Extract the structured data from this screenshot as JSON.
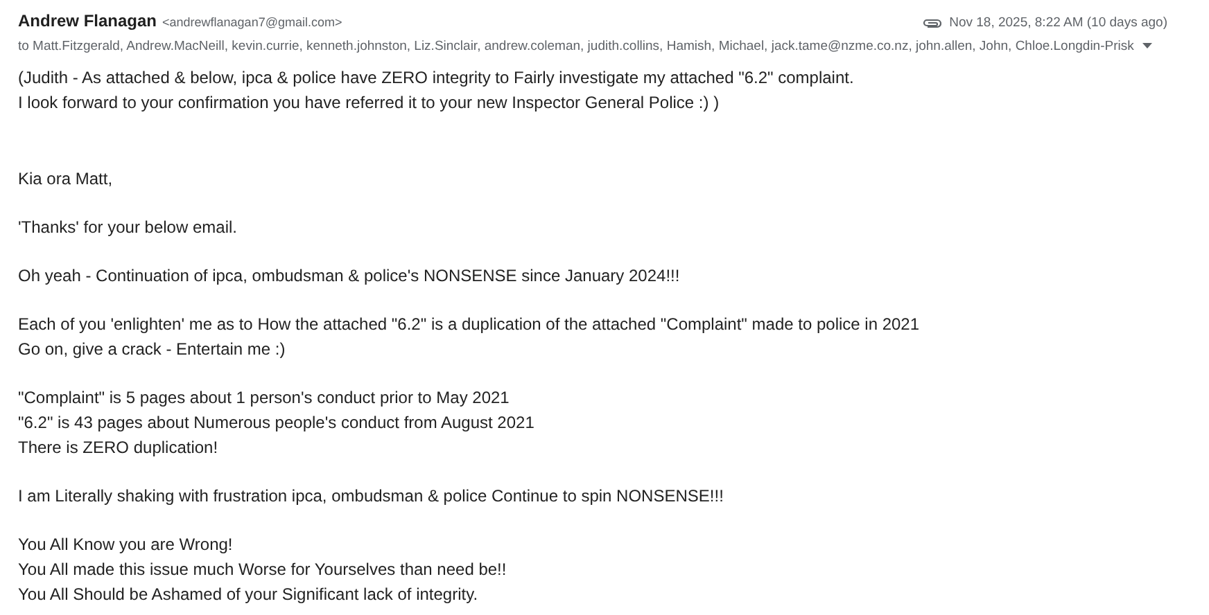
{
  "sender": {
    "name": "Andrew Flanagan",
    "email": "<andrewflanagan7@gmail.com>"
  },
  "date": "Nov 18, 2025, 8:22 AM (10 days ago)",
  "recipients": "to Matt.Fitzgerald, Andrew.MacNeill, kevin.currie, kenneth.johnston, Liz.Sinclair, andrew.coleman, judith.collins, Hamish, Michael, jack.tame@nzme.co.nz, john.allen, John, Chloe.Longdin-Prisk",
  "note": [
    "(Judith - As attached & below, ipca & police have ZERO integrity to Fairly investigate my attached \"6.2\" complaint.",
    "I look forward to your confirmation you have referred it to your new Inspector General Police :) )"
  ],
  "paragraphs": [
    [
      "Kia ora Matt,"
    ],
    [
      "'Thanks' for your below email."
    ],
    [
      "Oh yeah - Continuation of ipca, ombudsman & police's NONSENSE since January 2024!!!"
    ],
    [
      "Each of you 'enlighten' me as to How the attached \"6.2\" is a duplication of the attached \"Complaint\" made to police in 2021",
      "Go on, give a crack - Entertain me :)"
    ],
    [
      "\"Complaint\" is 5 pages about 1 person's conduct prior to May 2021",
      "\"6.2\" is 43 pages about Numerous people's conduct from August 2021",
      "There is ZERO duplication!"
    ],
    [
      "I am Literally shaking with frustration ipca, ombudsman & police Continue to spin NONSENSE!!!"
    ],
    [
      "You All Know you are Wrong!",
      "You All made this issue much Worse for Yourselves than need be!!",
      "You All Should be Ashamed of your Significant lack of integrity."
    ]
  ]
}
